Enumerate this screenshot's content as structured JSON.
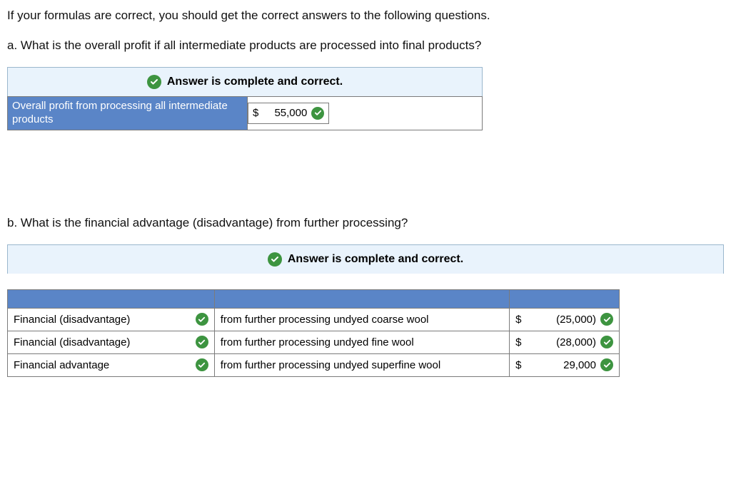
{
  "intro": "If your formulas are correct, you should get the correct answers to the following questions.",
  "partA": {
    "question": "a. What is the overall profit if all intermediate products are processed into final products?",
    "banner": "Answer is complete and correct.",
    "row_label": "Overall profit from processing all intermediate products",
    "currency": "$",
    "value": "55,000"
  },
  "partB": {
    "question": "b. What is the financial advantage (disadvantage) from further processing?",
    "banner": "Answer is complete and correct.",
    "rows": [
      {
        "type": "Financial (disadvantage)",
        "desc": "from further processing undyed coarse wool",
        "currency": "$",
        "amount": "(25,000)"
      },
      {
        "type": "Financial (disadvantage)",
        "desc": "from further processing undyed fine wool",
        "currency": "$",
        "amount": "(28,000)"
      },
      {
        "type": "Financial advantage",
        "desc": "from further processing undyed superfine wool",
        "currency": "$",
        "amount": "29,000"
      }
    ]
  }
}
